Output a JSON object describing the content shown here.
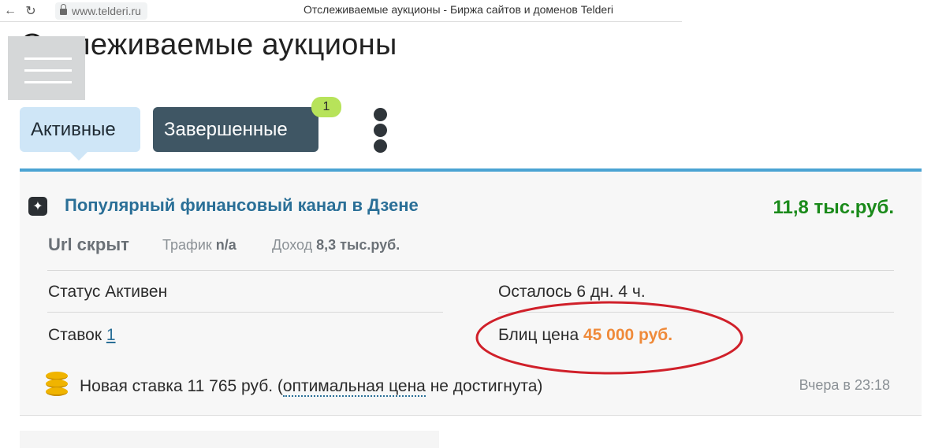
{
  "browser": {
    "url": "www.telderi.ru",
    "window_title": "Отслеживаемые аукционы - Биржа сайтов и доменов Telderi"
  },
  "page": {
    "title": "Отслеживаемые аукционы"
  },
  "tabs": [
    {
      "label": "Активные",
      "active": true
    },
    {
      "label": "Завершенные",
      "active": false,
      "badge": "1"
    }
  ],
  "listing": {
    "title": "Популярный финансовый канал в Дзене",
    "price": "11,8 тыс.руб.",
    "url_label": "Url скрыт",
    "traffic_label": "Трафик",
    "traffic_value": "n/a",
    "income_label": "Доход",
    "income_value": "8,3 тыс.руб.",
    "status_text": "Статус Активен",
    "remaining_text": "Осталось 6 дн. 4 ч.",
    "bids_label": "Ставок",
    "bids_count": "1",
    "blitz_label": "Блиц цена",
    "blitz_price": "45 000 руб.",
    "new_bid_prefix": "Новая ставка 11 765 руб. (",
    "new_bid_link": "оптимальная цена",
    "new_bid_suffix": " не достигнута)",
    "timestamp": "Вчера в 23:18"
  },
  "colors": {
    "accent_blue": "#4aa3d3",
    "price_green": "#1a8a1a",
    "blitz_orange": "#ef8a3a",
    "annotation_red": "#d0202a"
  },
  "icons": [
    "back-arrow-icon",
    "refresh-icon",
    "lock-icon",
    "hamburger-menu-icon",
    "more-vertical-icon",
    "zen-star-icon",
    "coins-icon"
  ]
}
